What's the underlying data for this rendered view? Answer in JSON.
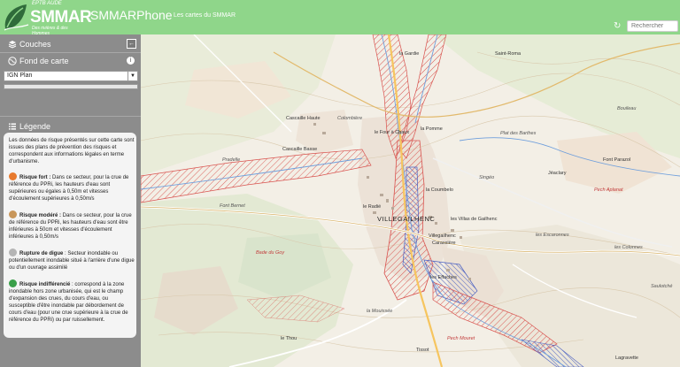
{
  "header": {
    "logo_top": "EPTB AUDE",
    "logo_main": "SMMAR",
    "logo_sub": "Des rivières & des Hommes",
    "app_title": "SMMARPhone",
    "app_subtitle": "Les cartes du SMMAR",
    "search_placeholder": "Rechercher"
  },
  "panel": {
    "layers_title": "Couches",
    "basemap_title": "Fond de carte",
    "basemap_selected": "IGN Plan",
    "legend_title": "Légende",
    "legend_intro": "Les données de risque présentés sur cette carte sont issues des plans de prévention des risques et correspondent aux informations légales en terme d'urbanisme.",
    "legend_items": [
      {
        "title": "Risque fort :",
        "text": " Dans ce secteur, pour la crue de référence du PPRi, les hauteurs d'eau sont supérieures ou égales à 0,50m et vitesses d'écoulement supérieures à 0,50m/s",
        "color": "#e87a2e"
      },
      {
        "title": "Risque modéré :",
        "text": " Dans ce secteur, pour la crue de référence du PPRi, les hauteurs d'eau sont être inférieures à 50cm et vitesses d'écoulement inférieures à 0,50m/s",
        "color": "#c8965a"
      },
      {
        "title": "Rupture de digue",
        "text": " : Secteur inondable ou potentiellement inondable situé à l'arrière d'une digue ou d'un ouvrage assimilé",
        "color": "#b5b5b5"
      },
      {
        "title": "Risque indifférencié",
        "text": " : correspond à la zone inondable hors zone urbanisée, qui est le champ d'expansion des crues, du cours d'eau, ou susceptible d'être inondable par débordement de cours d'eau (pour une crue supérieure à la crue de référence du PPRi) ou par ruissellement.",
        "color": "#3aa04a"
      }
    ]
  },
  "map": {
    "places": [
      {
        "label": "la Gardie",
        "cls": ""
      },
      {
        "label": "Saint-Roma",
        "cls": ""
      },
      {
        "label": "Colombière",
        "cls": "it"
      },
      {
        "label": "Cascaille Haute",
        "cls": ""
      },
      {
        "label": "le Four à Chaux",
        "cls": ""
      },
      {
        "label": "la Pomme",
        "cls": ""
      },
      {
        "label": "Plat des Barthes",
        "cls": "it"
      },
      {
        "label": "Cascaille Basse",
        "cls": ""
      },
      {
        "label": "Pradelle",
        "cls": "it"
      },
      {
        "label": "Jéaclary",
        "cls": ""
      },
      {
        "label": "Font Parazol",
        "cls": ""
      },
      {
        "label": "Singéo",
        "cls": "it"
      },
      {
        "label": "la Coumbelo",
        "cls": ""
      },
      {
        "label": "Pech Aplanat",
        "cls": "red"
      },
      {
        "label": "Font Bernet",
        "cls": "it"
      },
      {
        "label": "le Radié",
        "cls": ""
      },
      {
        "label": "VILLEGAILHENC",
        "cls": "big"
      },
      {
        "label": "les Villas de Gailhenc",
        "cls": ""
      },
      {
        "label": "Villegailhenc",
        "cls": ""
      },
      {
        "label": "Carassière",
        "cls": ""
      },
      {
        "label": "les Escaronnes",
        "cls": "it"
      },
      {
        "label": "Bade du Goy",
        "cls": "red"
      },
      {
        "label": "les Colonnes",
        "cls": "it"
      },
      {
        "label": "les Effaches",
        "cls": ""
      },
      {
        "label": "Saulotché",
        "cls": "it"
      },
      {
        "label": "la Mouissée",
        "cls": "it"
      },
      {
        "label": "le Thou",
        "cls": ""
      },
      {
        "label": "Pech Mouret",
        "cls": "red"
      },
      {
        "label": "Tissot",
        "cls": ""
      },
      {
        "label": "Lagravette",
        "cls": ""
      },
      {
        "label": "Bouileau",
        "cls": "it"
      }
    ]
  }
}
